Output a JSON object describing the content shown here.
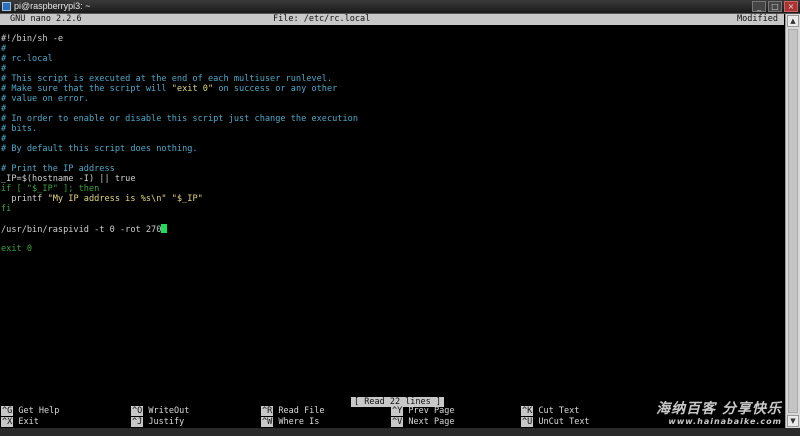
{
  "window": {
    "title": "pi@raspberrypi3: ~",
    "min": "_",
    "max": "□",
    "close": "×"
  },
  "nano": {
    "version": "GNU nano 2.2.6",
    "file": "File: /etc/rc.local",
    "state": "Modified"
  },
  "lines": [
    "#!/bin/sh -e",
    "#",
    "# rc.local",
    "#",
    "# This script is executed at the end of each multiuser runlevel.",
    "# Make sure that the script will \"exit 0\" on success or any other",
    "# value on error.",
    "#",
    "# In order to enable or disable this script just change the execution",
    "# bits.",
    "#",
    "# By default this script does nothing.",
    "",
    "# Print the IP address",
    "_IP=$(hostname -I) || true",
    "if [ \"$_IP\" ]; then",
    "  printf \"My IP address is %s\\n\" \"$_IP\"",
    "fi",
    "",
    "/usr/bin/raspivid -t 0 -rot 270",
    "",
    "exit 0"
  ],
  "status": "[ Read 22 lines ]",
  "shortcuts": [
    {
      "key": "^G",
      "label": "Get Help"
    },
    {
      "key": "^X",
      "label": "Exit"
    },
    {
      "key": "^O",
      "label": "WriteOut"
    },
    {
      "key": "^J",
      "label": "Justify"
    },
    {
      "key": "^R",
      "label": "Read File"
    },
    {
      "key": "^W",
      "label": "Where Is"
    },
    {
      "key": "^Y",
      "label": "Prev Page"
    },
    {
      "key": "^V",
      "label": "Next Page"
    },
    {
      "key": "^K",
      "label": "Cut Text"
    },
    {
      "key": "^U",
      "label": "UnCut Text"
    }
  ],
  "watermark": {
    "cn": "海纳百客 分享快乐",
    "en": "www.hainabaike.com"
  },
  "colors": {
    "comment": "#4fa8c8",
    "keyword": "#3aa33a",
    "string": "#e2d67a",
    "cursor": "#1fdc5a",
    "bar": "#c8c8c8"
  }
}
